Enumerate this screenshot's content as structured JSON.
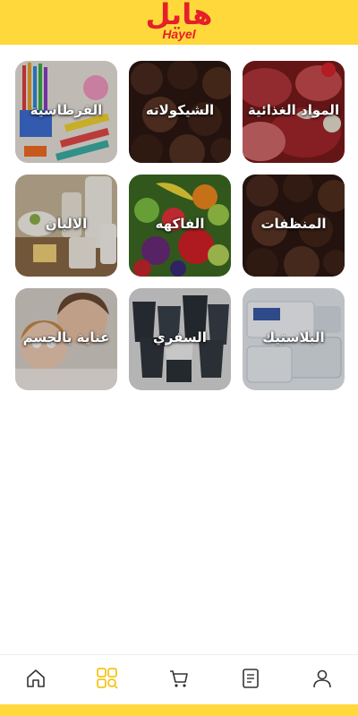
{
  "header": {
    "logo_ar": "هايل",
    "logo_en": "Hayel"
  },
  "colors": {
    "header_bg": "#FFD83B",
    "brand_red": "#E5202A",
    "nav_active": "#F5C518",
    "nav_inactive": "#333333"
  },
  "categories": [
    {
      "label": "المواد الغذائية",
      "icon": "meat-photo"
    },
    {
      "label": "الشيكولاته",
      "icon": "chocolate-photo"
    },
    {
      "label": "القرطاسية",
      "icon": "stationery-photo"
    },
    {
      "label": "المنظفات",
      "icon": "chocolate-photo"
    },
    {
      "label": "الفاكهه",
      "icon": "fruit-photo"
    },
    {
      "label": "الالبان",
      "icon": "dairy-photo"
    },
    {
      "label": "البلاستيك",
      "icon": "plastic-containers-photo"
    },
    {
      "label": "السفري",
      "icon": "paper-cups-photo"
    },
    {
      "label": "عناية بالجسم",
      "icon": "body-care-photo"
    }
  ],
  "bottom_nav": [
    {
      "name": "profile",
      "icon": "user-icon",
      "active": false
    },
    {
      "name": "orders",
      "icon": "document-icon",
      "active": false
    },
    {
      "name": "cart",
      "icon": "cart-icon",
      "active": false
    },
    {
      "name": "categories",
      "icon": "categories-search-icon",
      "active": true
    },
    {
      "name": "home",
      "icon": "home-icon",
      "active": false
    }
  ]
}
